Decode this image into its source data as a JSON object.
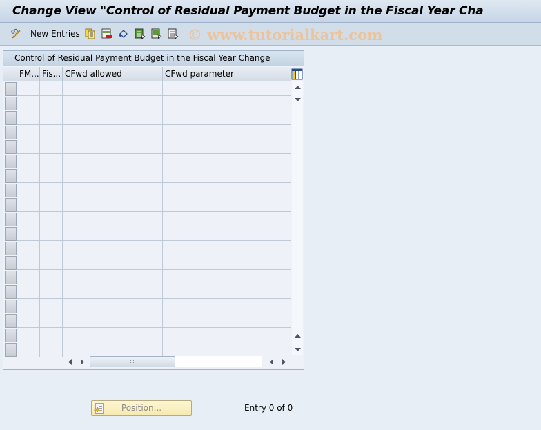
{
  "window": {
    "title": "Change View \"Control of Residual Payment Budget in the Fiscal Year Cha"
  },
  "toolbar": {
    "new_entries_label": "New Entries",
    "icons": [
      "glasses-pencil-icon",
      "copy-icon",
      "delete-icon",
      "undo-icon",
      "select-all-icon",
      "select-block-icon",
      "deselect-all-icon"
    ],
    "watermark": "© www.tutorialkart.com"
  },
  "table": {
    "title": "Control of Residual Payment Budget in the Fiscal Year Change",
    "columns": [
      "FM...",
      "Fis...",
      "CFwd allowed",
      "CFwd parameter"
    ],
    "row_count_visible": 19,
    "rows": []
  },
  "footer": {
    "position_label": "Position...",
    "entry_text": "Entry 0 of 0"
  },
  "colors": {
    "background": "#e8eef6",
    "watermark": "#f0c090",
    "position_button": "#f7eab0"
  }
}
